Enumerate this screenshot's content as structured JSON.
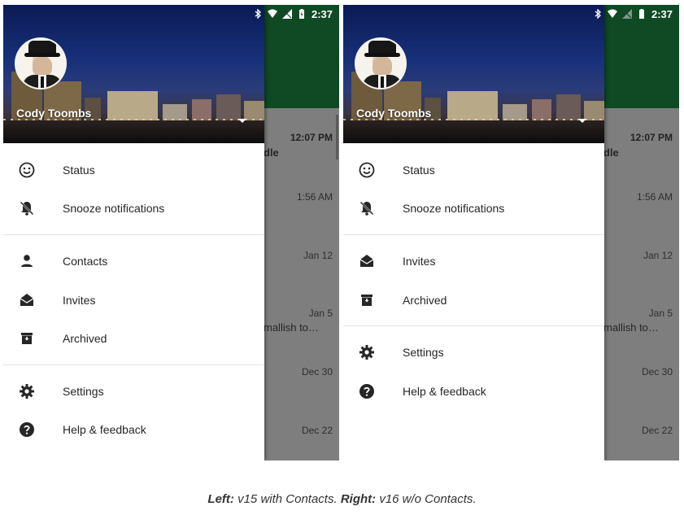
{
  "status_bar": {
    "time": "2:37"
  },
  "account": {
    "name": "Cody Toombs"
  },
  "left": {
    "menu_groups": [
      [
        {
          "label": "Status",
          "icon": "smiley-icon"
        },
        {
          "label": "Snooze notifications",
          "icon": "bell-off-icon"
        }
      ],
      [
        {
          "label": "Contacts",
          "icon": "person-icon"
        },
        {
          "label": "Invites",
          "icon": "envelope-open-icon"
        },
        {
          "label": "Archived",
          "icon": "archive-icon"
        }
      ],
      [
        {
          "label": "Settings",
          "icon": "gear-icon"
        },
        {
          "label": "Help & feedback",
          "icon": "help-circle-icon"
        }
      ]
    ]
  },
  "right": {
    "menu_groups": [
      [
        {
          "label": "Status",
          "icon": "smiley-icon"
        },
        {
          "label": "Snooze notifications",
          "icon": "bell-off-icon"
        }
      ],
      [
        {
          "label": "Invites",
          "icon": "envelope-open-icon"
        },
        {
          "label": "Archived",
          "icon": "archive-icon"
        }
      ],
      [
        {
          "label": "Settings",
          "icon": "gear-icon"
        },
        {
          "label": "Help & feedback",
          "icon": "help-circle-icon"
        }
      ]
    ]
  },
  "background_list": {
    "times": [
      "12:07 PM",
      "1:56 AM",
      "Jan 12",
      "Jan 5",
      "Dec 30",
      "Dec 22"
    ],
    "snippets": [
      "dle",
      "mallish to…"
    ]
  },
  "caption": {
    "left_bold": "Left:",
    "left_text": " v15 with Contacts. ",
    "right_bold": "Right:",
    "right_text": " v16 w/o Contacts."
  },
  "colors": {
    "app_bar": "#0f4a24",
    "scrim": "#7e7e7e",
    "icon": "#262626"
  }
}
